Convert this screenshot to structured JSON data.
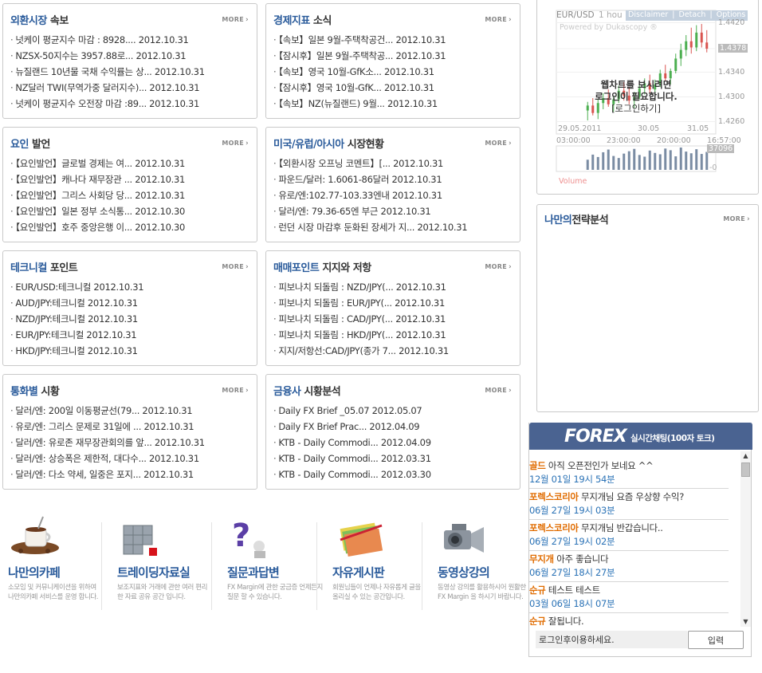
{
  "panels": [
    {
      "title_hl": "외환시장",
      "title_rest": " 속보",
      "more": "MORE",
      "items": [
        "넛케이 평균지수 마감 : 8928.... 2012.10.31",
        "NZSX-50지수는 3957.88로... 2012.10.31",
        "뉴질랜드 10년물 국채 수익률는 상... 2012.10.31",
        "NZ달러 TWI(무역가중 달러지수)... 2012.10.31",
        "넛케이 평균지수 오전장 마감 :89... 2012.10.31"
      ]
    },
    {
      "title_hl": "경제지표",
      "title_rest": " 소식",
      "more": "MORE",
      "items": [
        "【속보】일본 9월-주택착공건... 2012.10.31",
        "【잠시후】일본 9월-주택착공... 2012.10.31",
        "【속보】영국 10월-GfK소... 2012.10.31",
        "【잠시후】영국 10월-GfK... 2012.10.31",
        "【속보】NZ(뉴질랜드) 9월... 2012.10.31"
      ]
    },
    {
      "title_hl": "요인",
      "title_rest": " 발언",
      "more": "MORE",
      "items": [
        "【요인발언】글로벌 경제는 여... 2012.10.31",
        "【요인발언】캐나다 재무장관 ... 2012.10.31",
        "【요인발언】그리스 사회당 당... 2012.10.31",
        "【요인발언】일본 정부 소식통... 2012.10.30",
        "【요인발언】호주 중앙은행 이... 2012.10.30"
      ]
    },
    {
      "title_hl": "미국/유럽/아시아",
      "title_rest": " 시장현황",
      "more": "MORE",
      "items": [
        "【외환시장 오프닝 코멘트】[... 2012.10.31",
        "파운드/달러: 1.6061-86달러 2012.10.31",
        "유로/엔:102.77-103.33엔내 2012.10.31",
        "달러/엔: 79.36-65엔 부근 2012.10.31",
        "런던 시장 마감후 둔화된 장세가 지... 2012.10.31"
      ]
    },
    {
      "title_hl": "테크니컬",
      "title_rest": " 포인트",
      "more": "MORE",
      "items": [
        "EUR/USD:테크니컬 2012.10.31",
        "AUD/JPY:테크니컬 2012.10.31",
        "NZD/JPY:테크니컬 2012.10.31",
        "EUR/JPY:테크니컬 2012.10.31",
        "HKD/JPY:테크니컬 2012.10.31"
      ]
    },
    {
      "title_hl": "매매포인트",
      "title_rest": " 지지와 저항",
      "more": "MORE",
      "items": [
        "피보나치 되돌림 : NZD/JPY(... 2012.10.31",
        "피보나치 되돌림 : EUR/JPY(... 2012.10.31",
        "피보나치 되돌림 : CAD/JPY(... 2012.10.31",
        "피보나치 되돌림 : HKD/JPY(... 2012.10.31",
        "지지/저항선:CAD/JPY(종가 7... 2012.10.31"
      ]
    },
    {
      "title_hl": "통화별",
      "title_rest": " 시황",
      "more": "MORE",
      "items": [
        "달러/엔: 200일 이동평균선(79... 2012.10.31",
        "유로/엔: 그리스 문제로 31일에 ... 2012.10.31",
        "달러/엔: 유로존 재무장관회의를 앞... 2012.10.31",
        "달러/엔: 상승폭은 제한적, 대다수... 2012.10.31",
        "달러/엔: 다소 약세, 일중은 포지... 2012.10.31"
      ]
    },
    {
      "title_hl": "금융사",
      "title_rest": " 시황분석",
      "more": "MORE",
      "items": [
        "Daily FX Brief _05.07 2012.05.07",
        "Daily FX Brief Prac... 2012.04.09",
        "KTB - Daily Commodi... 2012.04.09",
        "KTB - Daily Commodi... 2012.03.31",
        "KTB - Daily Commodi... 2012.03.30"
      ]
    }
  ],
  "chart": {
    "symbol": "EUR/USD",
    "period": "1 hou",
    "disclaimer": "Disclaimer",
    "detach": "Detach",
    "options": "Options",
    "powered": "Powered by Dukascopy ®",
    "login_line1": "웹차트를 보시려면",
    "login_line2": "로그인이 필요합니다.",
    "login_link": "[로그인하기]",
    "price_labels": [
      "1.4420",
      "1.4378",
      "1.4340",
      "1.4300",
      "1.4260"
    ],
    "date_labels": [
      "29.05.2011",
      "30.05",
      "31.05"
    ],
    "time_labels": [
      "03:00:00",
      "23:00:00",
      "20:00:00",
      "16:57:00"
    ],
    "volume_value": "37096",
    "volume_zero": "-0",
    "volume_label": "Volume",
    "colors": {
      "bull": "#4caf50",
      "bear": "#d9534f"
    },
    "candles": [
      {
        "o": 1.4278,
        "h": 1.4292,
        "l": 1.4262,
        "c": 1.4286
      },
      {
        "o": 1.4286,
        "h": 1.4298,
        "l": 1.427,
        "c": 1.4274
      },
      {
        "o": 1.4274,
        "h": 1.4296,
        "l": 1.4264,
        "c": 1.429
      },
      {
        "o": 1.429,
        "h": 1.4306,
        "l": 1.428,
        "c": 1.4298
      },
      {
        "o": 1.4298,
        "h": 1.4312,
        "l": 1.4284,
        "c": 1.4288
      },
      {
        "o": 1.4288,
        "h": 1.4302,
        "l": 1.4276,
        "c": 1.4296
      },
      {
        "o": 1.4296,
        "h": 1.4318,
        "l": 1.429,
        "c": 1.431
      },
      {
        "o": 1.431,
        "h": 1.4324,
        "l": 1.4294,
        "c": 1.4302
      },
      {
        "o": 1.4302,
        "h": 1.4316,
        "l": 1.4288,
        "c": 1.4294
      },
      {
        "o": 1.4294,
        "h": 1.4308,
        "l": 1.4282,
        "c": 1.43
      },
      {
        "o": 1.43,
        "h": 1.432,
        "l": 1.4296,
        "c": 1.4314
      },
      {
        "o": 1.4314,
        "h": 1.433,
        "l": 1.4304,
        "c": 1.4322
      },
      {
        "o": 1.4322,
        "h": 1.4336,
        "l": 1.4306,
        "c": 1.4312
      },
      {
        "o": 1.4312,
        "h": 1.4328,
        "l": 1.4298,
        "c": 1.432
      },
      {
        "o": 1.432,
        "h": 1.4344,
        "l": 1.4316,
        "c": 1.4338
      },
      {
        "o": 1.4338,
        "h": 1.4352,
        "l": 1.4326,
        "c": 1.433
      },
      {
        "o": 1.433,
        "h": 1.4346,
        "l": 1.432,
        "c": 1.4342
      },
      {
        "o": 1.4342,
        "h": 1.437,
        "l": 1.4338,
        "c": 1.4362
      },
      {
        "o": 1.4362,
        "h": 1.4386,
        "l": 1.435,
        "c": 1.4376
      },
      {
        "o": 1.4376,
        "h": 1.44,
        "l": 1.4366,
        "c": 1.439
      },
      {
        "o": 1.439,
        "h": 1.4412,
        "l": 1.437,
        "c": 1.438
      },
      {
        "o": 1.438,
        "h": 1.4416,
        "l": 1.4374,
        "c": 1.4404
      },
      {
        "o": 1.4404,
        "h": 1.4418,
        "l": 1.438,
        "c": 1.4388
      },
      {
        "o": 1.4388,
        "h": 1.4408,
        "l": 1.4372,
        "c": 1.4378
      }
    ],
    "volumes": [
      30,
      45,
      38,
      52,
      60,
      41,
      35,
      48,
      55,
      62,
      44,
      39,
      57,
      50,
      46,
      63,
      58,
      40,
      66,
      54,
      49,
      61,
      47,
      53
    ]
  },
  "strategy": {
    "title_hl": "나만의",
    "title_rest": "전략분석",
    "more": "MORE"
  },
  "menu": [
    {
      "title": "나만의카페",
      "desc": "소모임 및 커뮤니케이션을 위하여 나만의카페 서비스를 운영 합니다."
    },
    {
      "title": "트레이딩자료실",
      "desc": "보조지표와 거래에 관한 여러 편리한 자료 공유 공간 입니다."
    },
    {
      "title": "질문과답변",
      "desc": "FX Margin에 관한 궁금증 언제든지 질문 할 수 있습니다."
    },
    {
      "title": "자유게시판",
      "desc": "회원님들이 언제나 자유롭게 글을 올리실 수 있는 공간입니다."
    },
    {
      "title": "동영상강의",
      "desc": "동영상 강의를 활용하시어 원활한 FX Margin 을 하시기 바랍니다."
    }
  ],
  "chat": {
    "logo": "FOREX",
    "subtitle": "실시간채팅(100자 토크)",
    "messages": [
      {
        "nick": "골드",
        "text": " 아직 오픈전인가 보네요 ^^",
        "time": "12월 01일 19시 54분"
      },
      {
        "nick": "포렉스코리아",
        "text": " 무지개님 요즘 우상향 수익?",
        "time": "06월 27일 19시 03분"
      },
      {
        "nick": "포렉스코리아",
        "text": " 무지개님 반갑습니다..",
        "time": "06월 27일 19시 02분"
      },
      {
        "nick": "무지개",
        "text": " 아주 좋습니다",
        "time": "06월 27일 18시 27분"
      },
      {
        "nick": "순규",
        "text": " 테스트 테스트",
        "time": "03월 06일 18시 07분"
      },
      {
        "nick": "순규",
        "text": " 잘됩니다.",
        "time": ""
      }
    ],
    "input_value": "로그인후이용하세요.",
    "send_label": "입력"
  }
}
